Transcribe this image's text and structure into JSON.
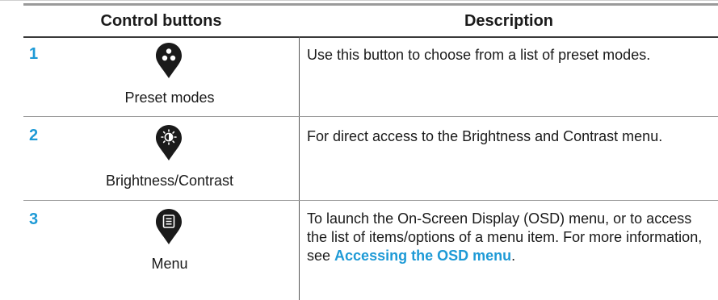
{
  "table": {
    "headers": {
      "control": "Control buttons",
      "description": "Description"
    },
    "rows": [
      {
        "number": "1",
        "icon": "preset-modes-icon",
        "label": "Preset modes",
        "description": "Use this button to choose from a list of preset modes."
      },
      {
        "number": "2",
        "icon": "brightness-contrast-icon",
        "label": "Brightness/Contrast",
        "description": "For direct access to the Brightness and Contrast menu."
      },
      {
        "number": "3",
        "icon": "menu-icon",
        "label": "Menu",
        "description_text": "To launch the On-Screen Display (OSD) menu, or to access the list of items/options of a menu item. For more information, see ",
        "description_link": "Accessing the OSD menu",
        "description_end": "."
      }
    ]
  },
  "colors": {
    "accent": "#1e9ad6",
    "icon": "#1a1a1a"
  }
}
